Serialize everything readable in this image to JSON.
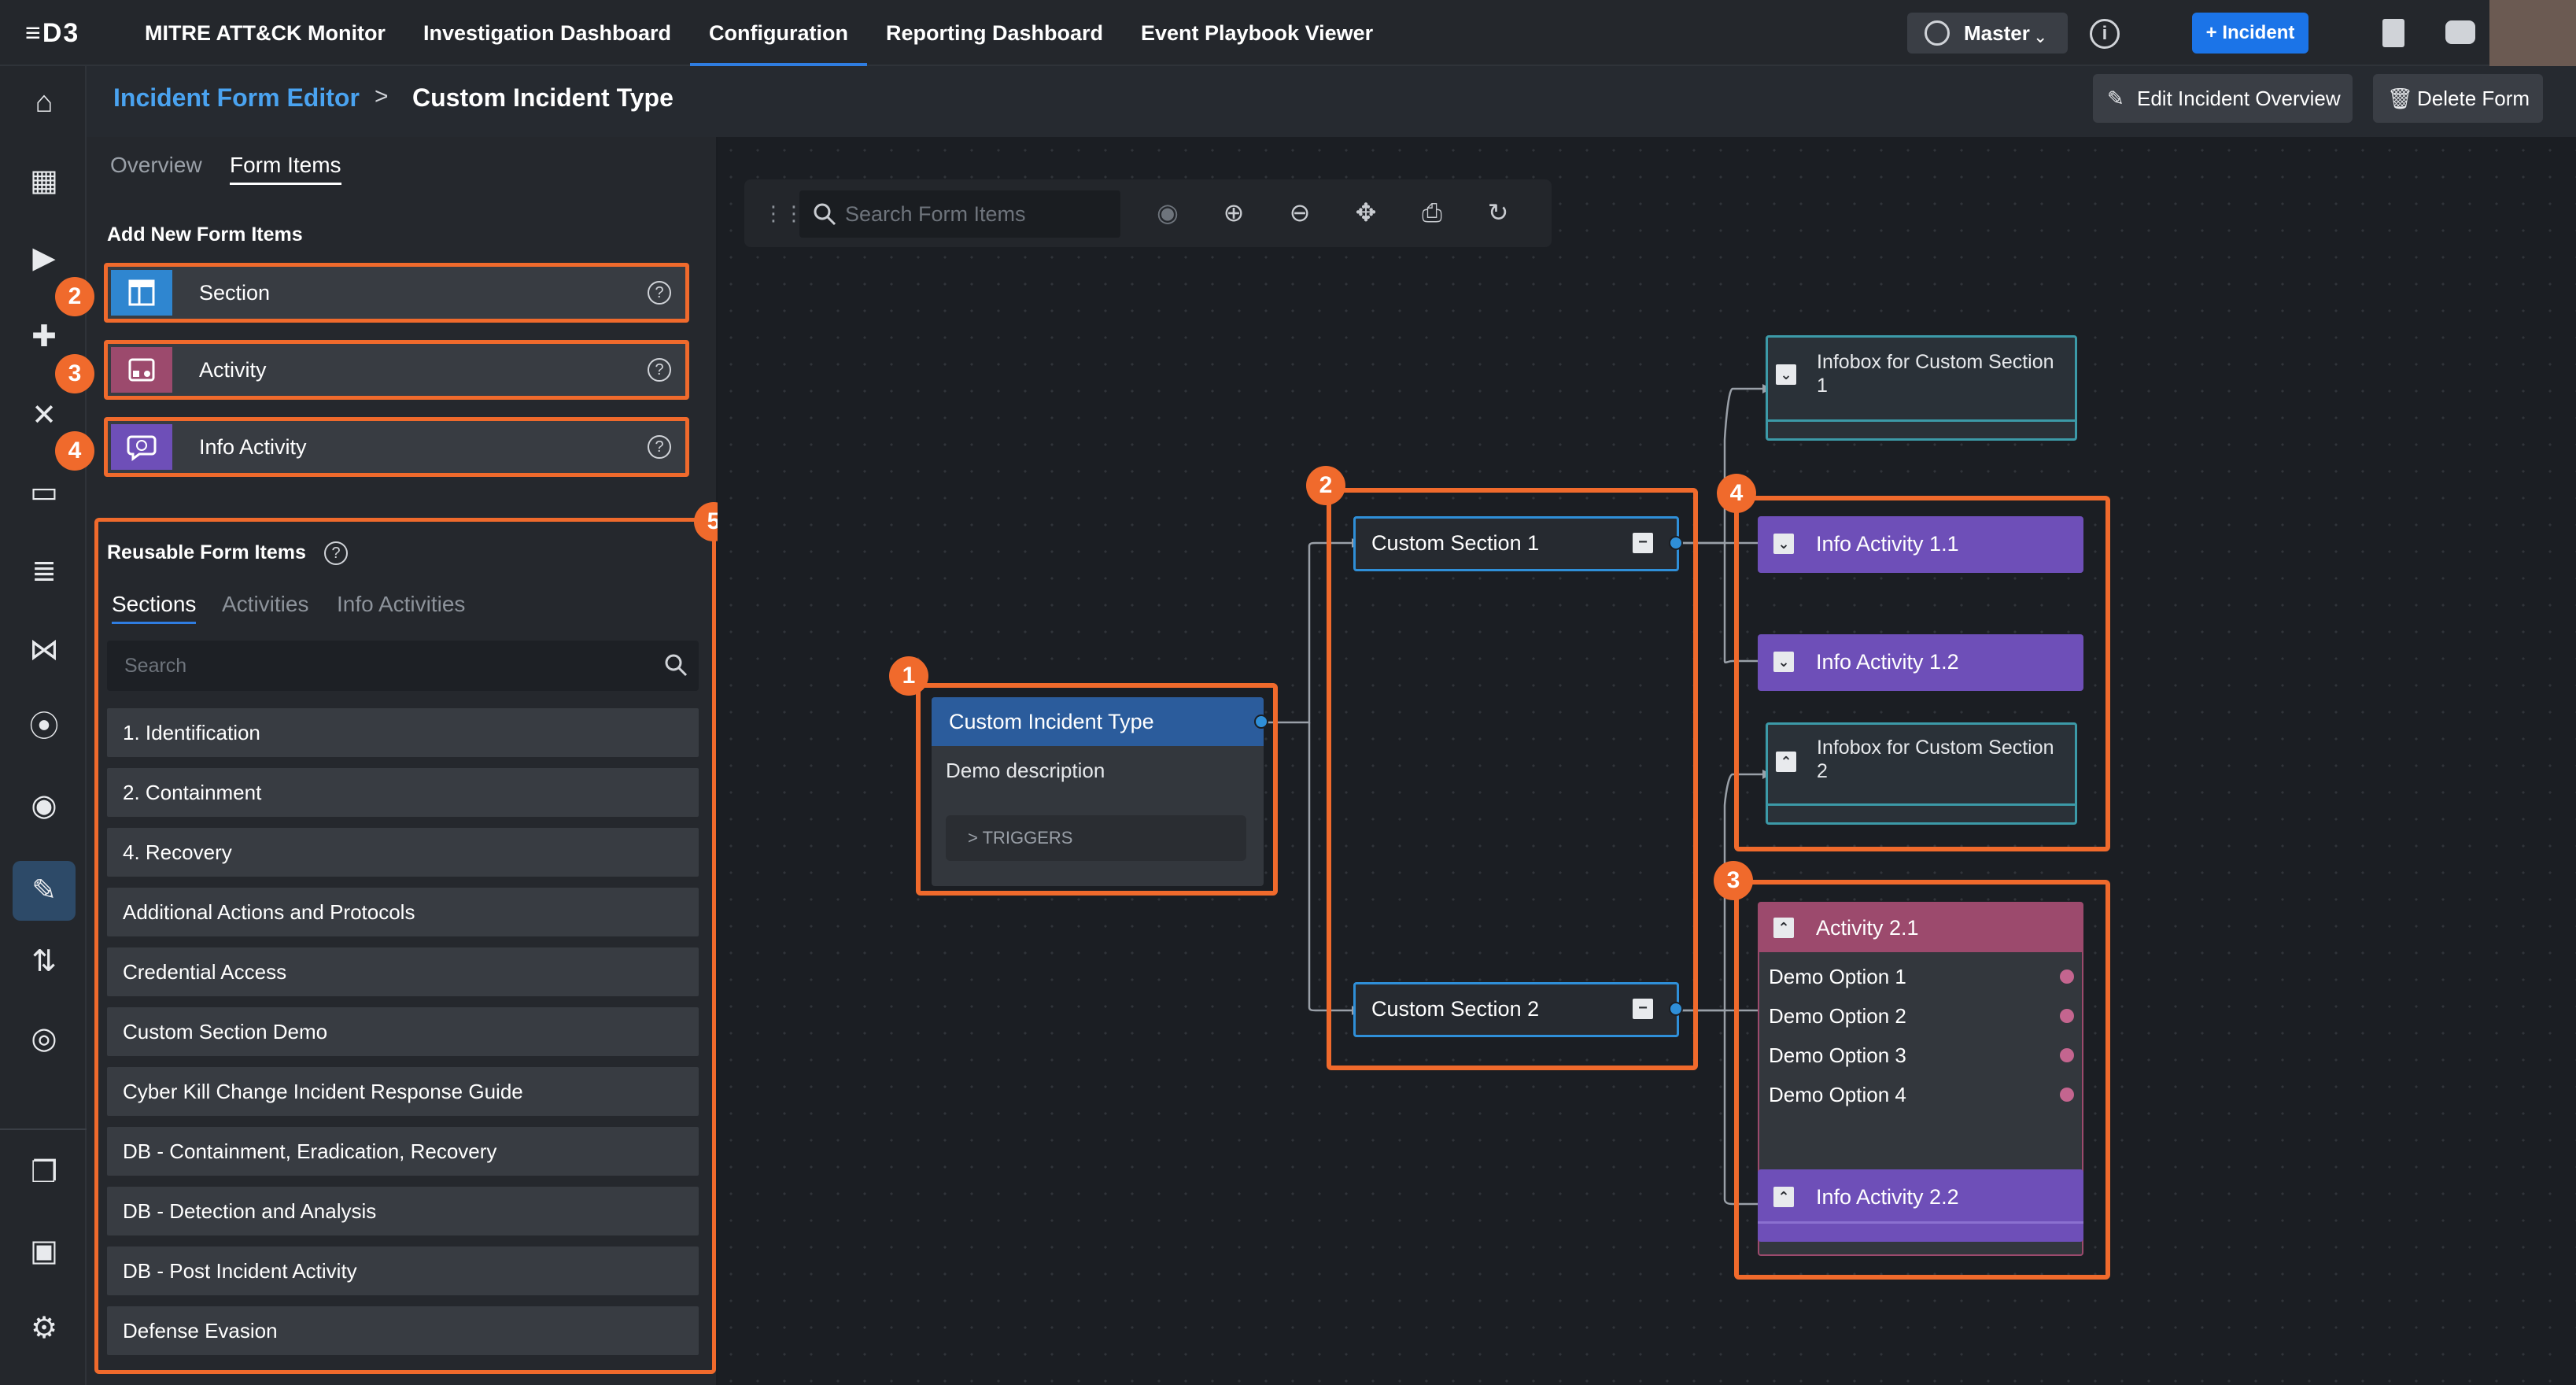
{
  "app": {
    "logo": "≡D3"
  },
  "topnav": {
    "items": [
      "MITRE ATT&CK Monitor",
      "Investigation Dashboard",
      "Configuration",
      "Reporting Dashboard",
      "Event Playbook Viewer"
    ],
    "active_index": 2,
    "master_label": "Master",
    "incident_button": "+ Incident"
  },
  "breadcrumb": {
    "parent": "Incident Form Editor",
    "separator": ">",
    "current": "Custom Incident Type",
    "edit_button": "Edit Incident Overview",
    "delete_button": "Delete Form"
  },
  "panel": {
    "tabs": [
      "Overview",
      "Form Items"
    ],
    "active_tab": "Form Items",
    "add_heading": "Add New Form Items",
    "add_items": [
      {
        "label": "Section",
        "badge": "2",
        "icon": "section-icon",
        "color": "#2f86d0"
      },
      {
        "label": "Activity",
        "badge": "3",
        "icon": "activity-icon",
        "color": "#9c4a6d"
      },
      {
        "label": "Info Activity",
        "badge": "4",
        "icon": "info-activity-icon",
        "color": "#6e4fb8"
      }
    ],
    "reusable_heading": "Reusable Form Items",
    "reusable_badge": "5",
    "sub_tabs": [
      "Sections",
      "Activities",
      "Info Activities"
    ],
    "active_sub_tab": "Sections",
    "search_placeholder": "Search",
    "sections": [
      "1. Identification",
      "2. Containment",
      "4. Recovery",
      "Additional Actions and Protocols",
      "Credential Access",
      "Custom Section Demo",
      "Cyber Kill Change Incident Response Guide",
      "DB - Containment, Eradication, Recovery",
      "DB - Detection and Analysis",
      "DB - Post Incident Activity",
      "Defense Evasion"
    ]
  },
  "canvas": {
    "search_placeholder": "Search Form Items",
    "tools": [
      "eye-icon",
      "zoom-in-icon",
      "zoom-out-icon",
      "fit-icon",
      "print-icon",
      "refresh-icon"
    ],
    "badges": {
      "root": "1",
      "sections": "2",
      "activity": "3",
      "info": "4"
    },
    "root": {
      "title": "Custom Incident Type",
      "description": "Demo description",
      "triggers": "> TRIGGERS"
    },
    "section1": "Custom Section 1",
    "section2": "Custom Section 2",
    "infobox1": "Infobox for Custom Section 1",
    "infobox2": "Infobox for Custom Section 2",
    "info_1_1": "Info Activity 1.1",
    "info_1_2": "Info Activity 1.2",
    "activity_2_1": {
      "title": "Activity 2.1",
      "options": [
        "Demo Option 1",
        "Demo Option 2",
        "Demo Option 3",
        "Demo Option 4"
      ]
    },
    "info_2_2": "Info Activity 2.2",
    "colors": {
      "accent": "#f06a2c",
      "section_border": "#2f8fd8",
      "root_header": "#2b5c9c",
      "info_activity": "#6e4fb8",
      "activity_header": "#9c4a6d",
      "infobox_border": "#3c9aa8"
    }
  }
}
